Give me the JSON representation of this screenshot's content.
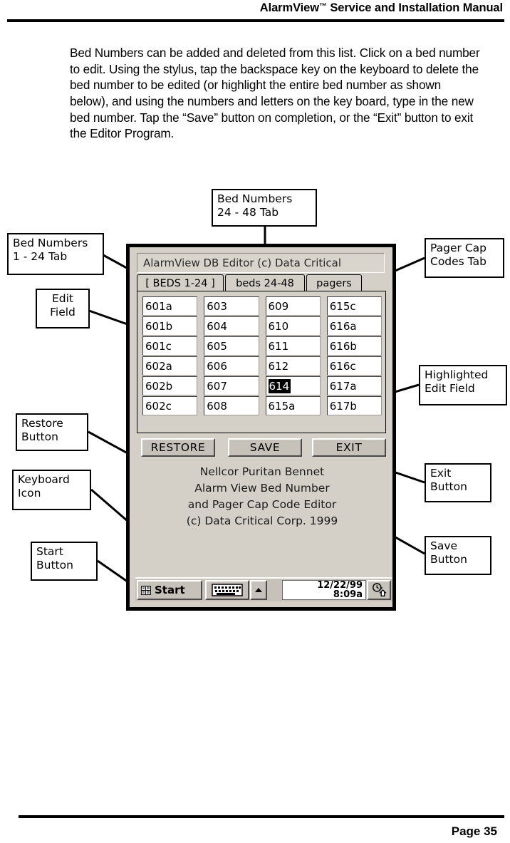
{
  "header": {
    "title_main": "AlarmView",
    "title_tm": "™",
    "title_rest": " Service and Installation Manual"
  },
  "body": {
    "paragraph": "Bed Numbers can be added and deleted from this list.  Click on a bed number to edit.  Using the stylus, tap the backspace key on the keyboard to delete the bed number to be edited (or highlight the entire bed number as shown below), and using the numbers and letters on the key board, type in the new bed number.  Tap the “Save” button on completion, or the “Exit” button to exit the Editor Program."
  },
  "footer": {
    "page_number": "Page 35"
  },
  "callouts": {
    "beds_1_24": "Bed Numbers\n1 - 24 Tab",
    "edit_field": "Edit\nField",
    "restore_button": "Restore\nButton",
    "keyboard_icon": "Keyboard\nIcon",
    "start_button": "Start\nButton",
    "beds_24_48": "Bed Numbers\n24 - 48 Tab",
    "pager_cap_codes": "Pager Cap\nCodes Tab",
    "highlighted_edit_field": "Highlighted\nEdit Field",
    "exit_button": "Exit\nButton",
    "save_button": "Save\nButton"
  },
  "device": {
    "app_title": "AlarmView DB Editor (c) Data Critical",
    "tabs": [
      {
        "id": "beds-1-24",
        "label": "[ BEDS 1-24 ]",
        "selected": true
      },
      {
        "id": "beds-24-48",
        "label": "beds 24-48",
        "selected": false
      },
      {
        "id": "pagers",
        "label": "pagers",
        "selected": false
      }
    ],
    "bed_columns": [
      [
        "601a",
        "601b",
        "601c",
        "602a",
        "602b",
        "602c"
      ],
      [
        "603",
        "604",
        "605",
        "606",
        "607",
        "608"
      ],
      [
        "609",
        "610",
        "611",
        "612",
        "614",
        "615a"
      ],
      [
        "615c",
        "616a",
        "616b",
        "616c",
        "617a",
        "617b"
      ]
    ],
    "highlighted_bed": {
      "column": 2,
      "row": 4,
      "value": "614"
    },
    "buttons": {
      "restore": "RESTORE",
      "save": "SAVE",
      "exit": "EXIT"
    },
    "credits": [
      "Nellcor Puritan Bennet",
      "Alarm View Bed Number",
      "and  Pager Cap Code Editor",
      "(c) Data Critical Corp. 1999"
    ],
    "taskbar": {
      "start_label": "Start",
      "date": "12/22/99",
      "time": "8:09a",
      "expand_glyph": "▲"
    }
  },
  "colors": {
    "ink": "#000000",
    "chrome_face": "#d4d0c8",
    "button_face": "#c6c2ba",
    "field_bg": "#ffffff",
    "selection_bg": "#000000",
    "selection_fg": "#ffffff"
  }
}
